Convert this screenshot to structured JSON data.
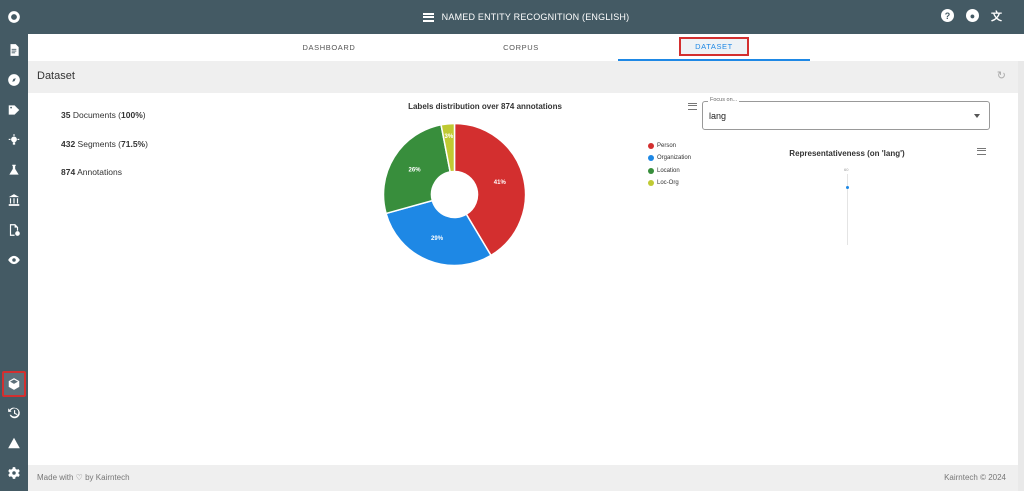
{
  "header": {
    "title": "NAMED ENTITY RECOGNITION (ENGLISH)",
    "help_icon": "help-icon",
    "account_icon": "account-icon",
    "translate_icon": "translate-icon"
  },
  "tabs": [
    {
      "label": "DASHBOARD",
      "active": false
    },
    {
      "label": "CORPUS",
      "active": false
    },
    {
      "label": "DATASET",
      "active": true
    }
  ],
  "section": {
    "title": "Dataset"
  },
  "stats": {
    "documents": {
      "count": "35",
      "label": " Documents (",
      "pct": "100%",
      "close": ")"
    },
    "segments": {
      "count": "432",
      "label": " Segments (",
      "pct": "71.5%",
      "close": ")"
    },
    "annotations": {
      "count": "874",
      "label": " Annotations"
    }
  },
  "chart_data": {
    "type": "pie",
    "title": "Labels distribution over 874 annotations",
    "categories": [
      "Person",
      "Organization",
      "Location",
      "Loc-Org"
    ],
    "values": [
      41,
      29,
      26,
      3
    ],
    "labels": [
      "41%",
      "29%",
      "26%",
      "3%"
    ],
    "colors": [
      "#d32f2f",
      "#1e88e5",
      "#388e3c",
      "#c0ca33"
    ],
    "donut": true,
    "legend_position": "right"
  },
  "focus": {
    "label": "Focus on...",
    "value": "lang"
  },
  "representativeness": {
    "title": "Representativeness (on 'lang')",
    "tick": "60"
  },
  "footer": {
    "left": "Made with ♡ by Kairntech",
    "right": "Kairntech © 2024"
  }
}
